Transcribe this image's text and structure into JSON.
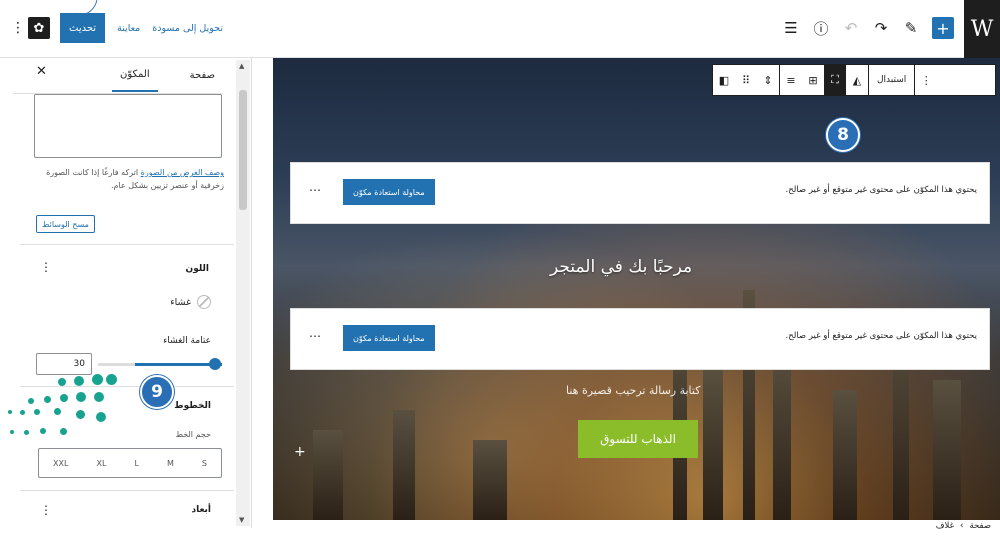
{
  "toolbar": {
    "update_label": "تحديث",
    "preview_label": "معاينة",
    "draft_label": "تحويل إلى مسودة"
  },
  "sidebar": {
    "tab_page": "صفحة",
    "tab_block": "المكوّن",
    "alt_help_link": "وصف الغرض من الصورة",
    "alt_help_text": " اتركه فارغًا إذا كانت الصورة زخرفية أو عنصر تزيين بشكل عام.",
    "clear_media_label": "مسح الوسائط",
    "color_title": "اللون",
    "overlay_label": "غشاء",
    "overlay_dim_label": "عتامة الغشاء",
    "overlay_dim_value": "30",
    "overlay_dim_percent": 30,
    "typography_title": "الخطوط",
    "font_size_label": "حجم الخط",
    "font_sizes": [
      "XXL",
      "XL",
      "L",
      "M",
      "S"
    ],
    "dimensions_title": "أبعاد"
  },
  "block_toolbar": {
    "replace_label": "استبدال"
  },
  "warnings": [
    {
      "text": "يحتوي هذا المكوّن على محتوى غير متوقع أو غير صالح.",
      "button": "محاولة استعادة مكوّن"
    },
    {
      "text": "يحتوي هذا المكوّن على محتوى غير متوقع أو غير صالح.",
      "button": "محاولة استعادة مكوّن"
    }
  ],
  "hero": {
    "title": "مرحبًا بك في المتجر",
    "subtitle": "كتابة رسالة ترحيب قصيرة هنا",
    "shop_button": "الذهاب للتسوق"
  },
  "breadcrumb": {
    "items": [
      "صفحة",
      "غلاف"
    ],
    "separator": "›"
  },
  "badges": {
    "b8": "8",
    "b9": "9"
  },
  "colors": {
    "accent": "#2271b1",
    "shop_button": "#8bbd2a",
    "badge": "#2a6fb6",
    "dots": "#17a38f"
  }
}
